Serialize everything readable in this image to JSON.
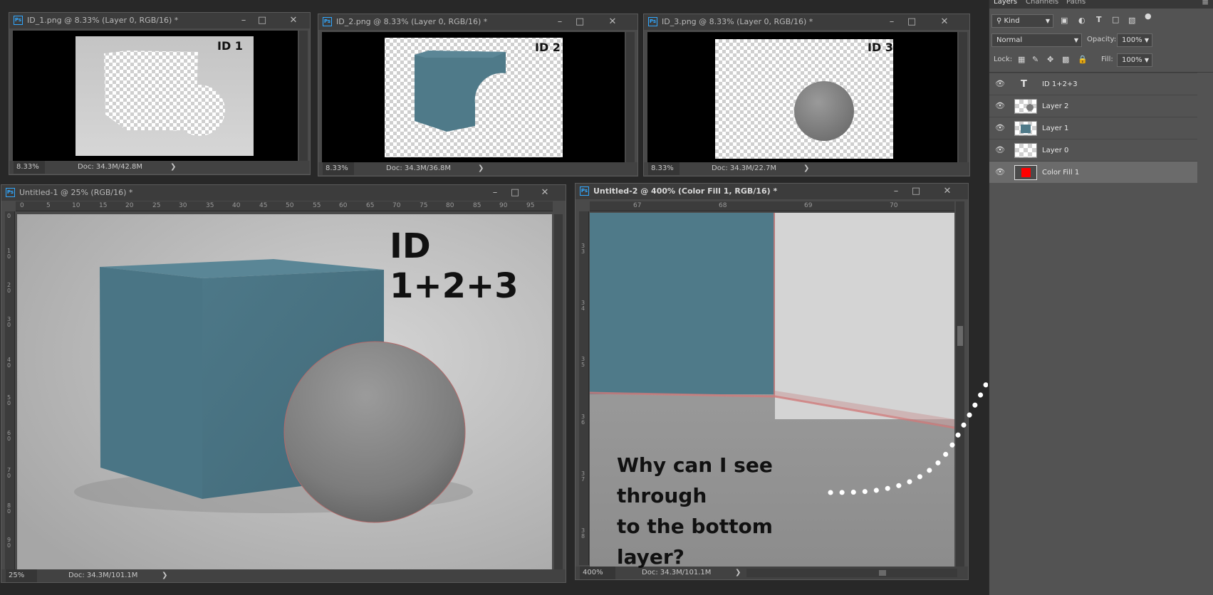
{
  "docs": {
    "id1": {
      "title": "ID_1.png @ 8.33% (Layer 0, RGB/16) *",
      "label": "ID 1",
      "zoom": "8.33%",
      "docsize": "Doc: 34.3M/42.8M"
    },
    "id2": {
      "title": "ID_2.png @ 8.33% (Layer 0, RGB/16) *",
      "label": "ID 2",
      "zoom": "8.33%",
      "docsize": "Doc: 34.3M/36.8M"
    },
    "id3": {
      "title": "ID_3.png @ 8.33% (Layer 0, RGB/16) *",
      "label": "ID 3",
      "zoom": "8.33%",
      "docsize": "Doc: 34.3M/22.7M"
    },
    "untitled1": {
      "title": "Untitled-1 @ 25% (RGB/16) *",
      "label": "ID 1+2+3",
      "zoom": "25%",
      "docsize": "Doc: 34.3M/101.1M",
      "ruler_h": [
        "0",
        "5",
        "10",
        "15",
        "20",
        "25",
        "30",
        "35",
        "40",
        "45",
        "50",
        "55",
        "60",
        "65",
        "70",
        "75",
        "80",
        "85",
        "90",
        "95"
      ],
      "ruler_v": [
        "0",
        "1 0",
        "2 0",
        "3 0",
        "4 0",
        "5 0",
        "6 0",
        "7 0",
        "8 0",
        "9 0"
      ]
    },
    "untitled2": {
      "title": "Untitled-2 @ 400% (Color Fill 1, RGB/16) *",
      "zoom": "400%",
      "docsize": "Doc: 34.3M/101.1M",
      "ruler_h": [
        "67",
        "68",
        "69",
        "70"
      ],
      "ruler_v": [
        "3 3",
        "3 4",
        "3 5",
        "3 6",
        "3 7",
        "3 8"
      ]
    }
  },
  "window_buttons": {
    "minimize": "–",
    "maximize": "□",
    "close": "✕"
  },
  "ps_icon": "Ps",
  "status_arrow": "❯",
  "layers_panel": {
    "tabs": [
      "Layers",
      "Channels",
      "Paths"
    ],
    "menu_icon": "≡",
    "filter_kind": "Kind",
    "blend_mode": "Normal",
    "opacity_label": "Opacity:",
    "opacity_value": "100%",
    "lock_label": "Lock:",
    "fill_label": "Fill:",
    "fill_value": "100%",
    "layers": [
      {
        "name": "ID 1+2+3",
        "type": "text",
        "type_icon": "T"
      },
      {
        "name": "Layer 2",
        "type": "pixel"
      },
      {
        "name": "Layer 1",
        "type": "pixel"
      },
      {
        "name": "Layer 0",
        "type": "pixel"
      },
      {
        "name": "Color Fill 1",
        "type": "fill",
        "fill_color": "#ff0000",
        "selected": true
      }
    ]
  },
  "annotation": {
    "line1": "Why can I see through",
    "line2": "to the bottom layer?"
  },
  "colors": {
    "cube": "#4f7a89",
    "sphere": "#8e8e8e",
    "accent": "#31a8ff",
    "fill_layer": "#ff0000"
  }
}
